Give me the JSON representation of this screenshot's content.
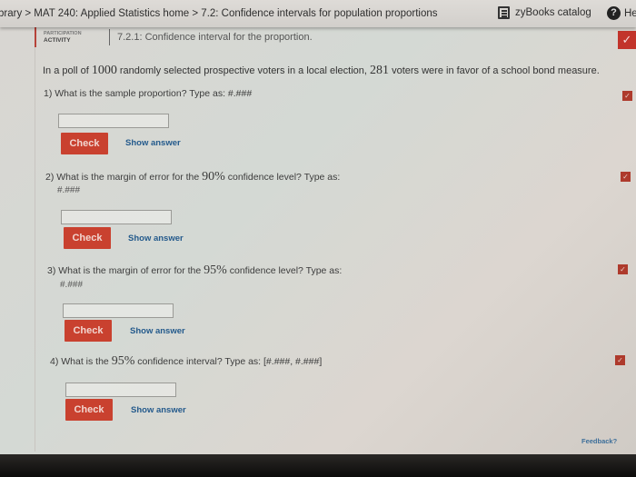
{
  "topbar": {
    "breadcrumb": "brary > MAT 240: Applied Statistics home > 7.2: Confidence intervals for population proportions",
    "catalog_label": "zyBooks catalog",
    "help_label": "He"
  },
  "activity": {
    "type_line1": "PARTICIPATION",
    "type_line2": "ACTIVITY",
    "title": "7.2.1: Confidence interval for the proportion.",
    "completed": true
  },
  "problem": {
    "intro_pre": "In a poll of ",
    "n": "1000",
    "intro_mid": " randomly selected prospective voters in a local election, ",
    "x": "281",
    "intro_post": " voters were in favor of a school bond measure."
  },
  "questions": [
    {
      "prefix": "1) What is the sample proportion? Type as: ",
      "num": "",
      "suffix": "",
      "format": "#.###",
      "value": "",
      "check_label": "Check",
      "show_label": "Show answer",
      "completed": true
    },
    {
      "prefix": "2) What is the margin of error for the ",
      "num": "90%",
      "suffix": " confidence level? Type as:",
      "format": "#.###",
      "value": "",
      "check_label": "Check",
      "show_label": "Show answer",
      "completed": true
    },
    {
      "prefix": "3) What is the margin of error for the ",
      "num": "95%",
      "suffix": " confidence level? Type as:",
      "format": "#.###",
      "value": "",
      "check_label": "Check",
      "show_label": "Show answer",
      "completed": true
    },
    {
      "prefix": "4) What is the ",
      "num": "95%",
      "suffix": " confidence interval? Type as: [#.###, #.###]",
      "format": "",
      "value": "",
      "check_label": "Check",
      "show_label": "Show answer",
      "completed": true
    }
  ],
  "feedback_label": "Feedback?",
  "icons": {
    "check": "✓",
    "help": "?"
  }
}
